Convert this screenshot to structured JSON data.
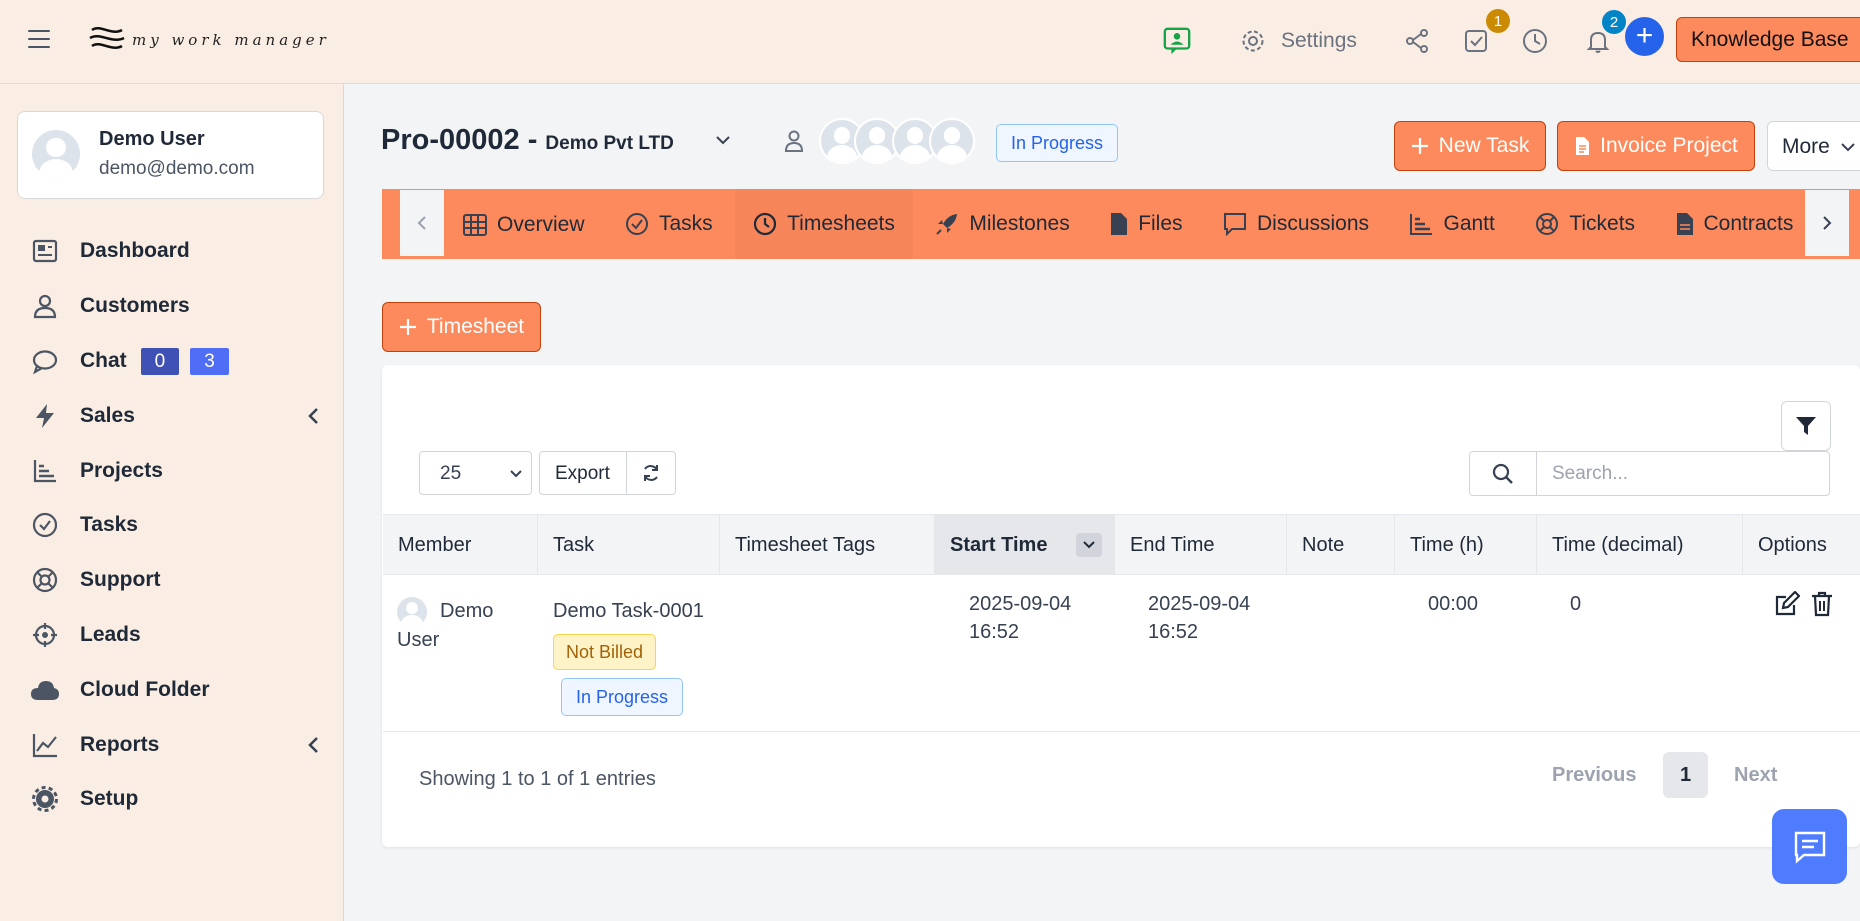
{
  "header": {
    "logo_text": "my work manager",
    "settings_label": "Settings",
    "todo_badge": "1",
    "notification_badge": "2",
    "knowledge_base_label": "Knowledge Base"
  },
  "user": {
    "name": "Demo User",
    "email": "demo@demo.com"
  },
  "sidebar": {
    "items": [
      {
        "label": "Dashboard"
      },
      {
        "label": "Customers"
      },
      {
        "label": "Chat",
        "badge_a": "0",
        "badge_b": "3"
      },
      {
        "label": "Sales"
      },
      {
        "label": "Projects"
      },
      {
        "label": "Tasks"
      },
      {
        "label": "Support"
      },
      {
        "label": "Leads"
      },
      {
        "label": "Cloud Folder"
      },
      {
        "label": "Reports"
      },
      {
        "label": "Setup"
      }
    ]
  },
  "project": {
    "code": "Pro-00002 -",
    "company": "Demo Pvt LTD",
    "status": "In Progress",
    "new_task_label": "New Task",
    "invoice_label": "Invoice Project",
    "more_label": "More"
  },
  "tabs": [
    {
      "label": "Overview"
    },
    {
      "label": "Tasks"
    },
    {
      "label": "Timesheets"
    },
    {
      "label": "Milestones"
    },
    {
      "label": "Files"
    },
    {
      "label": "Discussions"
    },
    {
      "label": "Gantt"
    },
    {
      "label": "Tickets"
    },
    {
      "label": "Contracts"
    }
  ],
  "timesheet": {
    "add_label": "Timesheet",
    "page_length": "25",
    "export_label": "Export",
    "search_placeholder": "Search...",
    "columns": [
      "Member",
      "Task",
      "Timesheet Tags",
      "Start Time",
      "End Time",
      "Note",
      "Time (h)",
      "Time (decimal)",
      "Options"
    ],
    "row": {
      "member_first": "Demo",
      "member_last": "User",
      "task": "Demo Task-0001",
      "billing": "Not Billed",
      "task_status": "In Progress",
      "tags": "",
      "start_date": "2025-09-04",
      "start_time": "16:52",
      "end_date": "2025-09-04",
      "end_time": "16:52",
      "note": "",
      "time_h": "00:00",
      "time_decimal": "0"
    },
    "showing": "Showing 1 to 1 of 1 entries",
    "prev_label": "Previous",
    "current_page": "1",
    "next_label": "Next"
  },
  "colors": {
    "accent": "#fd8a5c",
    "sidebar_bg": "#faeee4",
    "primary_blue": "#2563eb"
  }
}
